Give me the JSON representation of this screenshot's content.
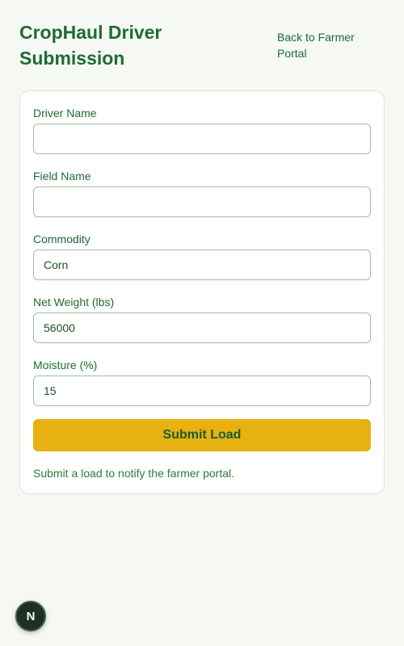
{
  "header": {
    "title": "CropHaul Driver Submission",
    "back_link": "Back to Farmer Portal"
  },
  "form": {
    "fields": [
      {
        "label": "Driver Name",
        "value": ""
      },
      {
        "label": "Field Name",
        "value": ""
      },
      {
        "label": "Commodity",
        "value": "Corn"
      },
      {
        "label": "Net Weight (lbs)",
        "value": "56000"
      },
      {
        "label": "Moisture (%)",
        "value": "15"
      }
    ],
    "submit_label": "Submit Load",
    "status": "Submit a load to notify the farmer portal."
  },
  "badge": {
    "letter": "N"
  },
  "colors": {
    "accent": "#e6b111",
    "text": "#1f6b34",
    "background": "#f5f8f3"
  }
}
